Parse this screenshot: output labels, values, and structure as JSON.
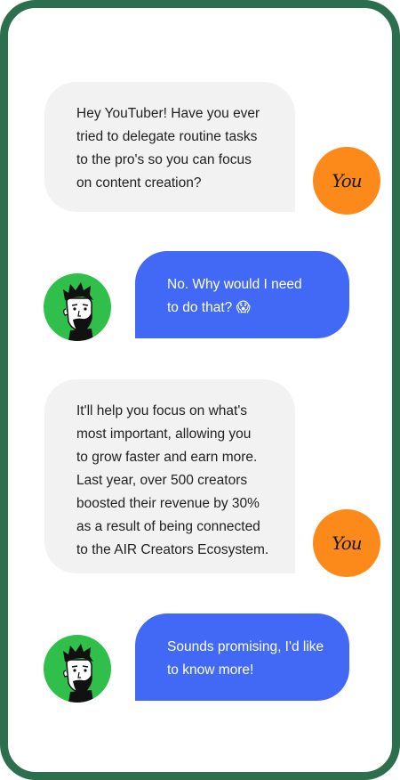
{
  "conversation": {
    "messages": [
      {
        "sender": "you",
        "text": "Hey YouTuber! Have you ever\ntried to delegate routine tasks\nto the pro's so you can focus\non content creation?"
      },
      {
        "sender": "creator",
        "text": "No. Why would I need\nto do that? 😱"
      },
      {
        "sender": "you",
        "text": "It'll help you focus on what's\nmost important, allowing you\nto grow faster and earn more.\nLast year, over 500 creators\nboosted their revenue by 30%\nas a result of being connected\nto the AIR Creators Ecosystem."
      },
      {
        "sender": "creator",
        "text": "Sounds promising, I'd like\nto know more!"
      }
    ],
    "you_avatar_label": "You"
  },
  "colors": {
    "frame": "#2b6f4f",
    "incoming_bubble": "#f2f2f2",
    "outgoing_bubble": "#4169f5",
    "you_avatar": "#fb8a1a",
    "creator_avatar": "#2fbf4a"
  },
  "icons": {
    "you_avatar": "you-avatar-icon",
    "creator_avatar": "creator-face-icon"
  }
}
